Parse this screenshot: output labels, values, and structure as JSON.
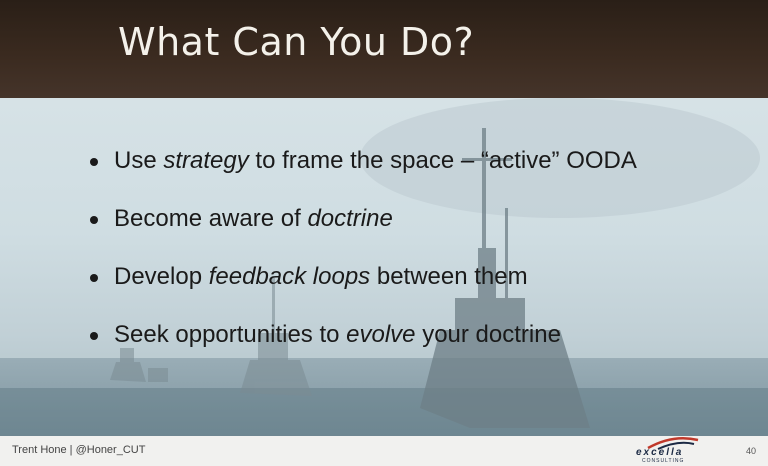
{
  "slide": {
    "title": "What Can You Do?",
    "bullets": [
      {
        "before": "Use ",
        "em": "strategy",
        "after": " to frame the space – “active” OODA"
      },
      {
        "before": "Become aware of ",
        "em": "doctrine",
        "after": ""
      },
      {
        "before": "Develop ",
        "em": "feedback loops",
        "after": " between them"
      },
      {
        "before": "Seek opportunities to ",
        "em": "evolve",
        "after": " your doctrine"
      }
    ]
  },
  "footer": {
    "author": "Trent Hone | @Honer_CUT",
    "logo_word": "excella",
    "logo_sub": "CONSULTING",
    "page_number": "40"
  },
  "icons": {
    "background": "warship-photo",
    "logo_mark": "excella-swoosh-icon",
    "bullet": "bullet-dot-icon"
  }
}
